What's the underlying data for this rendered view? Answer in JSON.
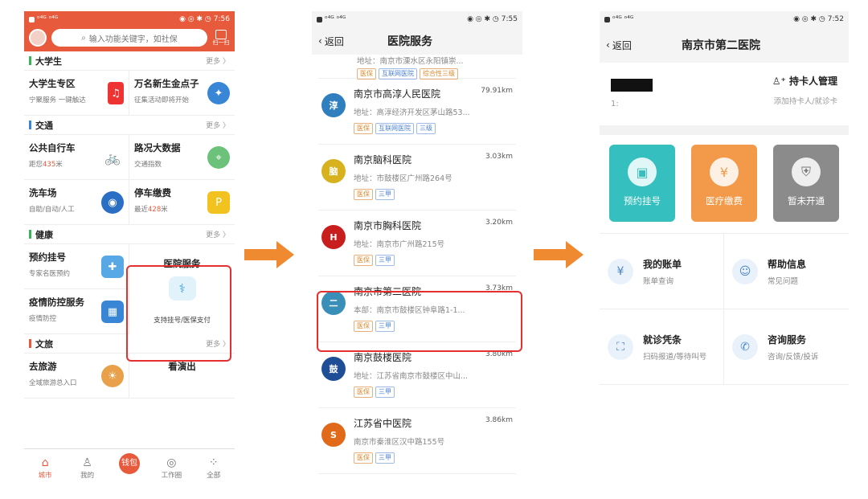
{
  "phone1": {
    "status_time": "7:56",
    "search_placeholder": "输入功能关键字，如社保",
    "scan_label": "扫一扫",
    "more": "更多",
    "sections": {
      "college": {
        "title": "大学生",
        "color": "#3cb35a",
        "items": [
          {
            "name": "大学生专区",
            "sub": "宁聚服务 一键触达",
            "icon": "college-icon"
          },
          {
            "name": "万名新生金点子",
            "sub": "征集活动即将开始",
            "icon": "lightbulb-icon"
          }
        ]
      },
      "traffic": {
        "title": "交通",
        "color": "#3a86d6",
        "items": [
          {
            "name": "公共自行车",
            "sub_prefix": "距您",
            "sub_value": "435",
            "sub_suffix": "米",
            "icon": "bicycle-icon"
          },
          {
            "name": "路况大数据",
            "sub": "交通指数",
            "icon": "map-icon"
          },
          {
            "name": "洗车场",
            "sub": "自助/自动/人工",
            "icon": "car-wash-icon"
          },
          {
            "name": "停车缴费",
            "sub_prefix": "最近",
            "sub_value": "428",
            "sub_suffix": "米",
            "icon": "parking-icon"
          }
        ]
      },
      "health": {
        "title": "健康",
        "color": "#3cb35a",
        "items": [
          {
            "name": "预约挂号",
            "sub": "专家名医预约",
            "icon": "appointment-icon"
          },
          {
            "name": "疫情防控服务",
            "sub": "疫情防控",
            "icon": "epidemic-icon"
          }
        ],
        "feature": {
          "name": "医院服务",
          "sub": "支持挂号/医保支付",
          "icon": "doctor-icon"
        }
      },
      "culture": {
        "title": "文旅",
        "color": "#e85a3c",
        "items": [
          {
            "name": "去旅游",
            "sub": "全域旅游总入口",
            "icon": "travel-icon"
          },
          {
            "name": "看演出",
            "sub": "",
            "icon": "show-icon"
          }
        ]
      }
    },
    "tabs": [
      {
        "label": "城市",
        "icon": "home-icon"
      },
      {
        "label": "我的",
        "icon": "user-icon"
      },
      {
        "label": "钱包",
        "icon": "wallet-icon"
      },
      {
        "label": "工作圈",
        "icon": "circle-icon"
      },
      {
        "label": "全部",
        "icon": "grid-icon"
      }
    ]
  },
  "phone2": {
    "status_time": "7:55",
    "back": "返回",
    "title": "医院服务",
    "partial": {
      "address": "地址：南京市溧水区永阳镇崇...",
      "tags": [
        "医保",
        "互联网医院",
        "综合性三级"
      ]
    },
    "hospitals": [
      {
        "name": "南京市高淳人民医院",
        "distance": "79.91km",
        "address": "地址：高淳经济开发区茅山路53...",
        "tags": [
          "医保",
          "互联网医院",
          "三级"
        ],
        "logo_color": "#2f7fbf",
        "logo": "淳"
      },
      {
        "name": "南京脑科医院",
        "distance": "3.03km",
        "address": "地址：市鼓楼区广州路264号",
        "tags": [
          "医保",
          "三甲"
        ],
        "logo_color": "#d8b21e",
        "logo": "脑"
      },
      {
        "name": "南京市胸科医院",
        "distance": "3.20km",
        "address": "地址：南京市广州路215号",
        "tags": [
          "医保",
          "三甲"
        ],
        "logo_color": "#c81e1e",
        "logo": "H"
      },
      {
        "name": "南京市第二医院",
        "distance": "3.73km",
        "address": "本部：南京市鼓楼区钟阜路1-1...",
        "tags": [
          "医保",
          "三甲"
        ],
        "logo_color": "#3a8fb8",
        "logo": "二"
      },
      {
        "name": "南京鼓楼医院",
        "distance": "3.80km",
        "address": "地址：江苏省南京市鼓楼区中山...",
        "tags": [
          "医保",
          "三甲"
        ],
        "logo_color": "#1f4e96",
        "logo": "鼓"
      },
      {
        "name": "江苏省中医院",
        "distance": "3.86km",
        "address": "南京市秦淮区汉中路155号",
        "tags": [
          "医保",
          "三甲"
        ],
        "logo_color": "#e06a1a",
        "logo": "S"
      }
    ]
  },
  "phone3": {
    "status_time": "7:52",
    "back": "返回",
    "title": "南京市第二医院",
    "id_fragment": "1:",
    "card_manage": "持卡人管理",
    "card_manage_sub": "添加持卡人/就诊卡",
    "tiles": [
      {
        "label": "预约挂号",
        "color": "#35c0bf",
        "icon": "phone-appointment-icon"
      },
      {
        "label": "医疗缴费",
        "color": "#f29a4a",
        "icon": "payment-icon"
      },
      {
        "label": "暂未开通",
        "color": "#8b8b8b",
        "icon": "bed-icon"
      }
    ],
    "services": [
      {
        "name": "我的账单",
        "sub": "账单查询",
        "icon": "bill-icon"
      },
      {
        "name": "帮助信息",
        "sub": "常见问题",
        "icon": "help-icon"
      },
      {
        "name": "就诊凭条",
        "sub": "扫码报道/等待叫号",
        "icon": "scan-icon"
      },
      {
        "name": "咨询服务",
        "sub": "咨询/反馈/投诉",
        "icon": "phone-icon"
      }
    ]
  },
  "colors": {
    "brand": "#e85a3c",
    "arrow": "#f08a30",
    "highlight": "#e53030"
  }
}
